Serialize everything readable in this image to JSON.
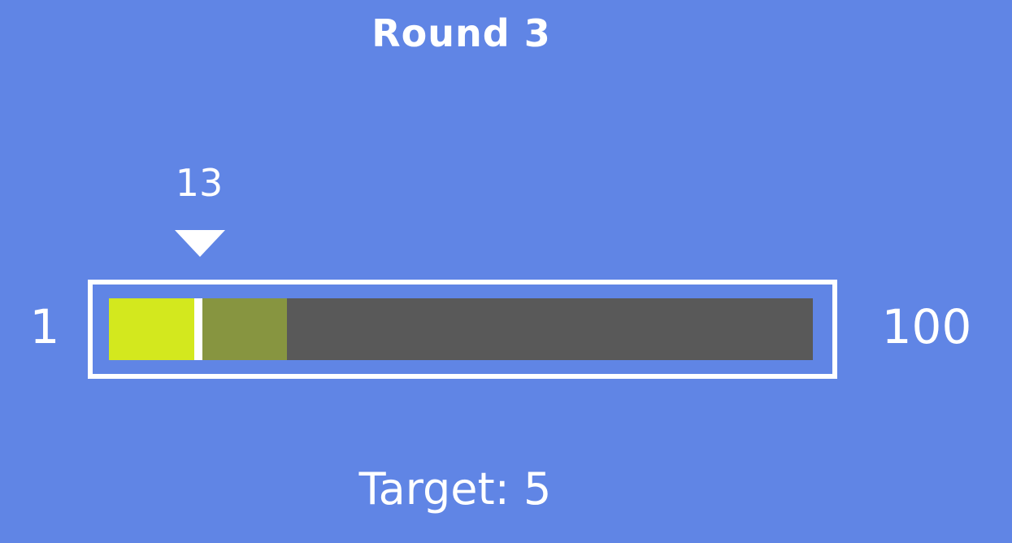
{
  "round": {
    "title": "Round 3"
  },
  "slider": {
    "min_label": "1",
    "max_label": "100",
    "min": 1,
    "max": 100,
    "guess_value": 13,
    "guess_label": "13",
    "range_high": 26,
    "colors": {
      "background": "#6085e5",
      "fill": "#d3e81e",
      "range": "#879540",
      "track": "#595959",
      "needle": "#ffffff"
    }
  },
  "target": {
    "label": "Target: 5"
  }
}
